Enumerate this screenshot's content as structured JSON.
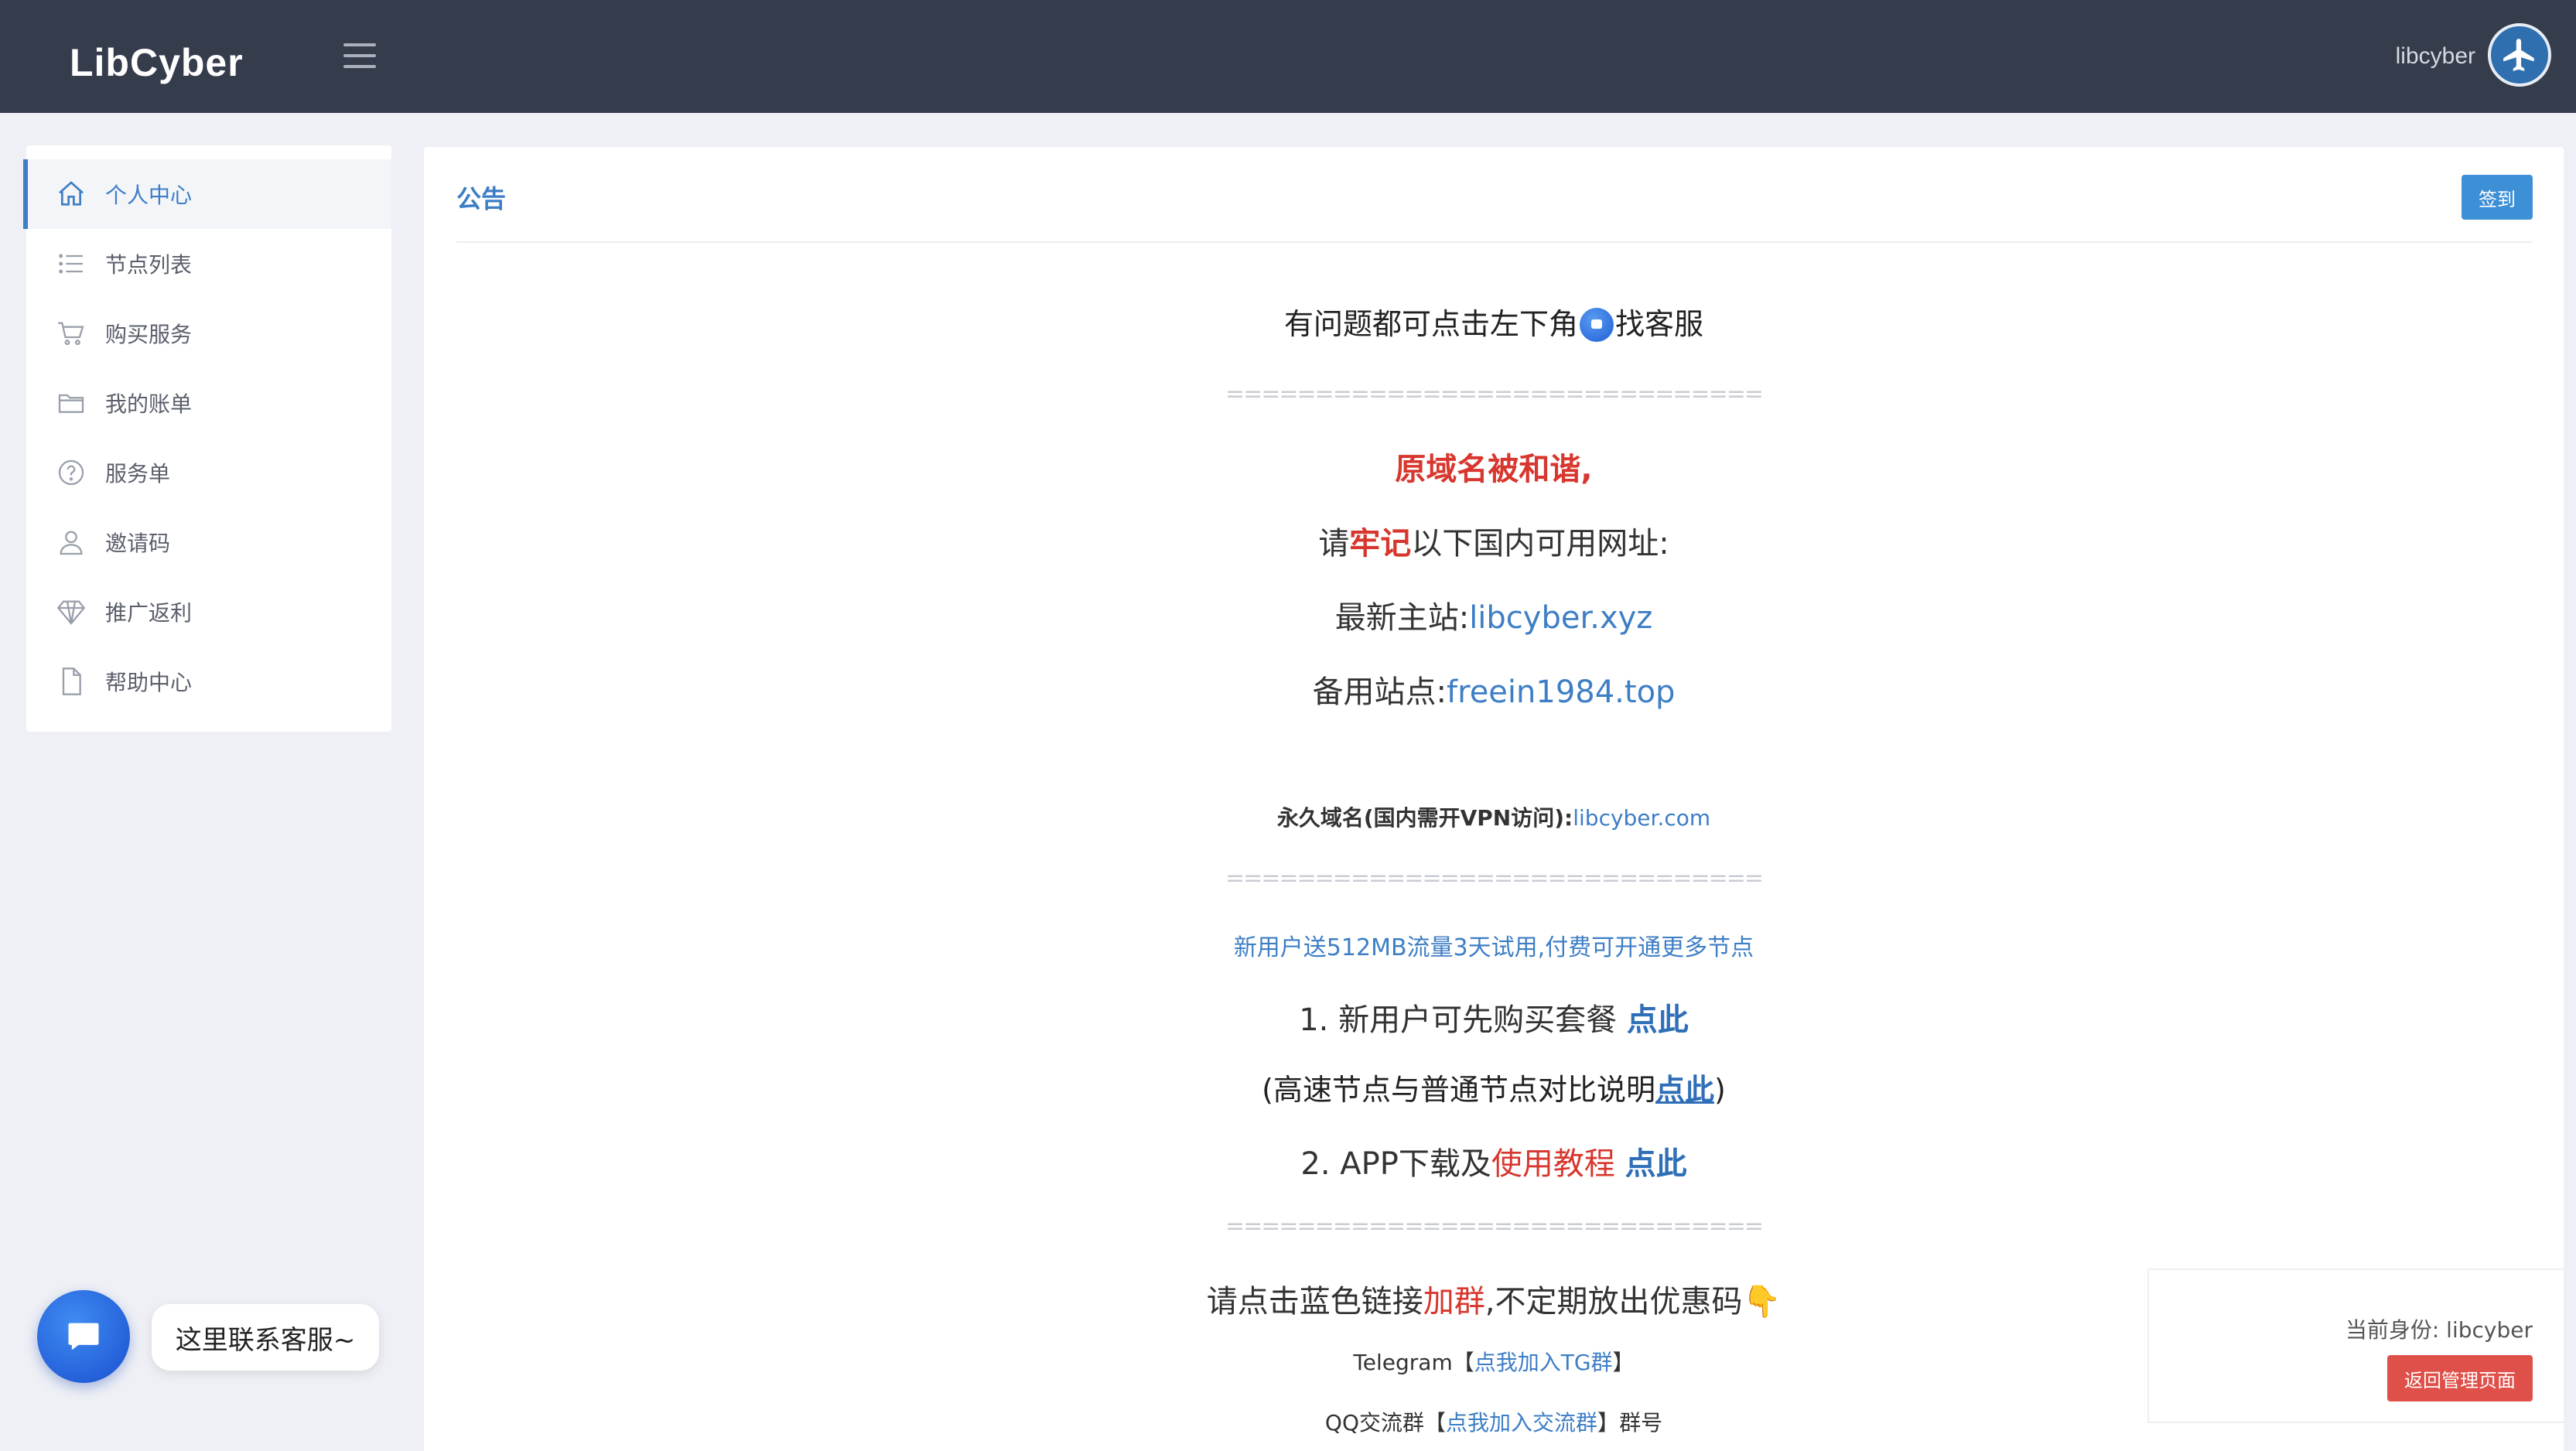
{
  "header": {
    "brand": "LibCyber",
    "username": "libcyber",
    "menu_icon": "hamburger-icon",
    "avatar_icon": "airplane-icon"
  },
  "sidebar": {
    "items": [
      {
        "label": "个人中心",
        "icon": "home-icon",
        "active": true
      },
      {
        "label": "节点列表",
        "icon": "list-icon"
      },
      {
        "label": "购买服务",
        "icon": "cart-icon"
      },
      {
        "label": "我的账单",
        "icon": "folder-icon"
      },
      {
        "label": "服务单",
        "icon": "question-icon"
      },
      {
        "label": "邀请码",
        "icon": "user-icon"
      },
      {
        "label": "推广返利",
        "icon": "diamond-icon"
      },
      {
        "label": "帮助中心",
        "icon": "document-icon"
      }
    ]
  },
  "announcement": {
    "title": "公告",
    "signin_label": "签到",
    "support_prefix": "有问题都可点击左下角",
    "support_suffix": "找客服",
    "separator": "==============================",
    "domain_notice": "原域名被和谐,",
    "remember_pre": "请",
    "remember_emph": "牢记",
    "remember_post": "以下国内可用网址:",
    "main_site_label": "最新主站:",
    "main_site_url": "libcyber.xyz",
    "backup_site_label": "备用站点:",
    "backup_site_url": "freein1984.top",
    "permanent_label": "永久域名(国内需开VPN访问):",
    "permanent_url": "libcyber.com",
    "trial_notice": "新用户送512MB流量3天试用,付费可开通更多节点",
    "step1_text": "1. 新用户可先购买套餐",
    "step1_link": "点此",
    "compare_pre": "(高速节点与普通节点对比说明",
    "compare_link": "点此",
    "compare_post": ")",
    "step2_pre": "2. APP下载及",
    "step2_emph": "使用教程",
    "step2_link": "点此",
    "group_pre": "请点击蓝色链接",
    "group_emph": "加群",
    "group_post": ",不定期放出优惠码👇",
    "telegram_label": "Telegram",
    "telegram_link": "点我加入TG群",
    "qq_label": "QQ交流群",
    "qq_link": "点我加入交流群",
    "qq_post": "群号"
  },
  "identity": {
    "text": "当前身份: libcyber",
    "back_button": "返回管理页面"
  },
  "chat": {
    "icon": "chat-icon",
    "bubble_text": "这里联系客服~"
  },
  "colors": {
    "header_bg": "#353c4c",
    "accent_blue": "#3d7ec5",
    "notice_red": "#d7372e",
    "back_button_red": "#e0504a"
  }
}
